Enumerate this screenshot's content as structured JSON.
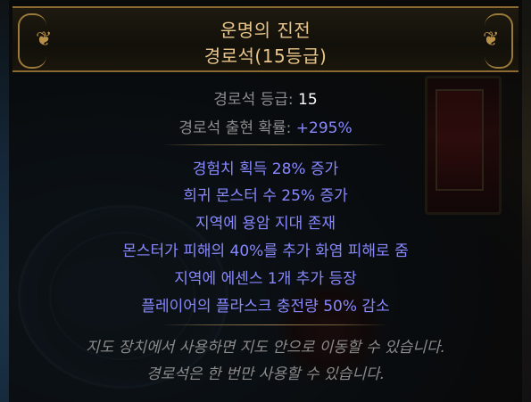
{
  "item": {
    "name": "운명의 진전",
    "base": "경로석(15등급)"
  },
  "properties": [
    {
      "label": "경로석 등급: ",
      "value": "15",
      "value_color": "white"
    },
    {
      "label": "경로석 출현 확률: ",
      "value": "+295%",
      "value_color": "blue"
    }
  ],
  "mods": [
    "경험치 획득 28% 증가",
    "희귀 몬스터 수 25% 증가",
    "지역에 용암 지대 존재",
    "몬스터가 피해의 40%를 추가 화염 피해로 줌",
    "지역에 에센스 1개 추가 등장",
    "플레이어의 플라스크 충전량 50% 감소"
  ],
  "flavor": [
    "지도 장치에서 사용하면 지도 안으로 이동할 수 있습니다.",
    "경로석은 한 번만 사용할 수 있습니다."
  ],
  "colors": {
    "title": "#e8c58a",
    "mod_blue": "#8888ff",
    "label_gray": "#8c8c8c",
    "frame_gold": "#8a6a30"
  }
}
